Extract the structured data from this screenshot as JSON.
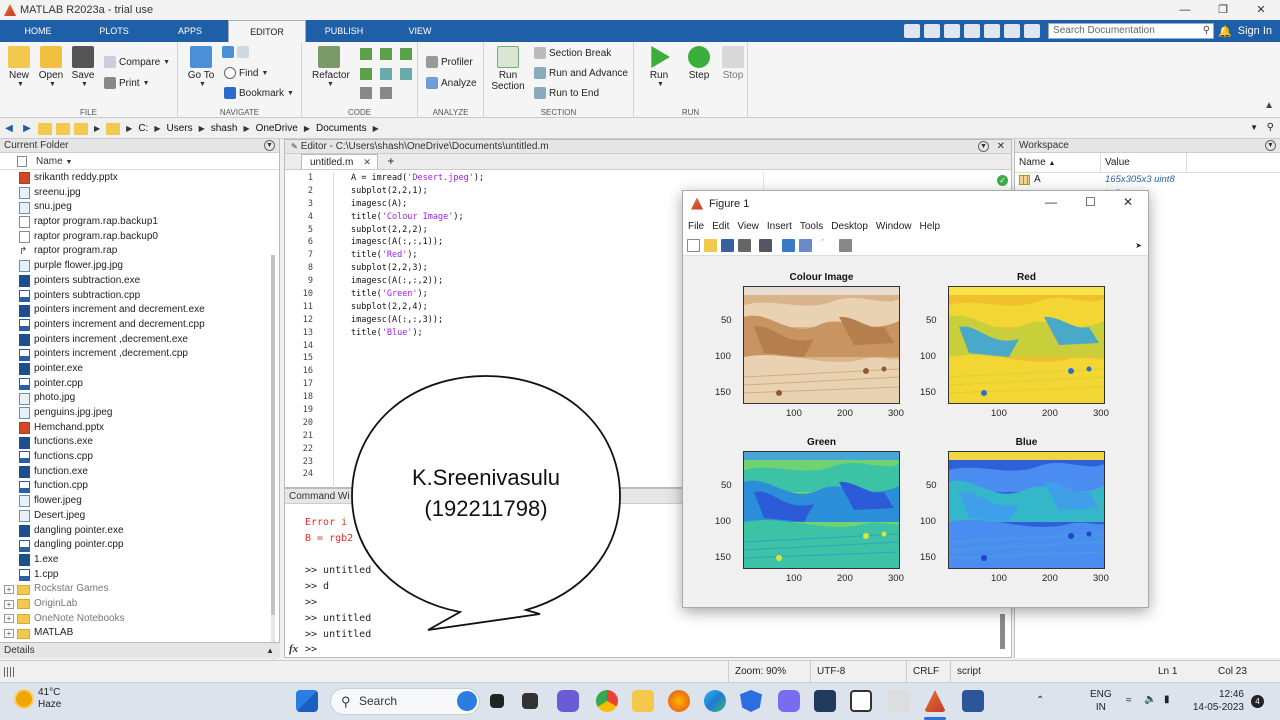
{
  "app": {
    "title": "MATLAB R2023a - trial use"
  },
  "tabs": [
    "HOME",
    "PLOTS",
    "APPS",
    "EDITOR",
    "PUBLISH",
    "VIEW"
  ],
  "active_tab": "EDITOR",
  "search": {
    "placeholder": "Search Documentation"
  },
  "signin": "Sign In",
  "ribbon": {
    "file": {
      "label": "FILE",
      "new": "New",
      "open": "Open",
      "save": "Save",
      "compare": "Compare",
      "print": "Print"
    },
    "navigate": {
      "label": "NAVIGATE",
      "goto": "Go To",
      "find": "Find",
      "bookmark": "Bookmark"
    },
    "code": {
      "label": "CODE",
      "refactor": "Refactor"
    },
    "analyze": {
      "label": "ANALYZE",
      "profiler": "Profiler",
      "analyze": "Analyze"
    },
    "section": {
      "label": "SECTION",
      "run_section": "Run\nSection",
      "section_break": "Section Break",
      "run_and_advance": "Run and Advance",
      "run_to_end": "Run to End"
    },
    "run": {
      "label": "RUN",
      "run": "Run",
      "step": "Step",
      "stop": "Stop"
    }
  },
  "address": [
    "C:",
    "Users",
    "shash",
    "OneDrive",
    "Documents"
  ],
  "current_folder": {
    "title": "Current Folder",
    "column": "Name",
    "files": [
      {
        "name": "srikanth reddy.pptx",
        "type": "ppt"
      },
      {
        "name": "sreenu.jpg",
        "type": "img"
      },
      {
        "name": "snu.jpeg",
        "type": "img"
      },
      {
        "name": "raptor program.rap.backup1",
        "type": "bak"
      },
      {
        "name": "raptor program.rap.backup0",
        "type": "bak"
      },
      {
        "name": "raptor program.rap",
        "type": "rap"
      },
      {
        "name": "purple flower.jpg.jpg",
        "type": "img"
      },
      {
        "name": "pointers subtraction.exe",
        "type": "exe"
      },
      {
        "name": "pointers subtraction.cpp",
        "type": "cpp"
      },
      {
        "name": "pointers increment and decrement.exe",
        "type": "exe"
      },
      {
        "name": "pointers increment and decrement.cpp",
        "type": "cpp"
      },
      {
        "name": "pointers increment ,decrement.exe",
        "type": "exe"
      },
      {
        "name": "pointers increment ,decrement.cpp",
        "type": "cpp"
      },
      {
        "name": "pointer.exe",
        "type": "exe"
      },
      {
        "name": "pointer.cpp",
        "type": "cpp"
      },
      {
        "name": "photo.jpg",
        "type": "img"
      },
      {
        "name": "penguins.jpg.jpeg",
        "type": "img"
      },
      {
        "name": "Hemchand.pptx",
        "type": "ppt"
      },
      {
        "name": "functions.exe",
        "type": "exe"
      },
      {
        "name": "functions.cpp",
        "type": "cpp"
      },
      {
        "name": "function.exe",
        "type": "exe"
      },
      {
        "name": "function.cpp",
        "type": "cpp"
      },
      {
        "name": "flower.jpeg",
        "type": "img"
      },
      {
        "name": "Desert.jpeg",
        "type": "img"
      },
      {
        "name": "dangling pointer.exe",
        "type": "exe"
      },
      {
        "name": "dangling pointer.cpp",
        "type": "cpp"
      },
      {
        "name": "1.exe",
        "type": "exe"
      },
      {
        "name": "1.cpp",
        "type": "cpp"
      }
    ],
    "folders": [
      "Rockstar Games",
      "OriginLab",
      "OneNote Notebooks",
      "MATLAB"
    ]
  },
  "details": "Details",
  "editor": {
    "path": "Editor - C:\\Users\\shash\\OneDrive\\Documents\\untitled.m",
    "tab": "untitled.m",
    "lines": [
      {
        "pre": "A = imread(",
        "str": "'Desert.jpeg'",
        "post": ");"
      },
      {
        "pre": "subplot(2,2,1);",
        "str": "",
        "post": ""
      },
      {
        "pre": "imagesc(A);",
        "str": "",
        "post": ""
      },
      {
        "pre": "title(",
        "str": "'Colour Image'",
        "post": ");"
      },
      {
        "pre": "subplot(2,2,2);",
        "str": "",
        "post": ""
      },
      {
        "pre": "imagesc(A(:,:,1));",
        "str": "",
        "post": ""
      },
      {
        "pre": "title(",
        "str": "'Red'",
        "post": ");"
      },
      {
        "pre": "subplot(2,2,3);",
        "str": "",
        "post": ""
      },
      {
        "pre": "imagesc(A(:,:,2));",
        "str": "",
        "post": ""
      },
      {
        "pre": "title(",
        "str": "'Green'",
        "post": ");"
      },
      {
        "pre": "subplot(2,2,4);",
        "str": "",
        "post": ""
      },
      {
        "pre": "imagesc(A(:,:,3));",
        "str": "",
        "post": ""
      },
      {
        "pre": "title(",
        "str": "'Blue'",
        "post": ");"
      }
    ],
    "line_count": 24
  },
  "command_window": {
    "title": "Command Wi",
    "lines": [
      {
        "text": "Error i",
        "err": true
      },
      {
        "text": "B = rgb2",
        "err": true
      },
      {
        "text": "",
        "err": false
      },
      {
        "text": ">> untitled",
        "err": false
      },
      {
        "text": ">> d",
        "err": false
      },
      {
        "text": ">>",
        "err": false
      },
      {
        "text": ">> untitled",
        "err": false
      },
      {
        "text": ">> untitled",
        "err": false
      }
    ],
    "prompt": ">>",
    "fx": "fx"
  },
  "workspace": {
    "title": "Workspace",
    "columns": [
      "Name",
      "Value"
    ],
    "rows": [
      {
        "name": "A",
        "value": "165x305x3 uint8"
      },
      {
        "name": "",
        "value": "int8"
      },
      {
        "name": "",
        "value": "ogical"
      }
    ]
  },
  "status": {
    "zoom": "Zoom: 90%",
    "encoding": "UTF-8",
    "eol": "CRLF",
    "type": "script",
    "ln": "Ln  1",
    "col": "Col  23"
  },
  "figure": {
    "title": "Figure 1",
    "menu": [
      "File",
      "Edit",
      "View",
      "Insert",
      "Tools",
      "Desktop",
      "Window",
      "Help"
    ],
    "plots": [
      {
        "title": "Colour Image",
        "yticks": [
          "50",
          "100",
          "150"
        ],
        "xticks": [
          "100",
          "200",
          "300"
        ],
        "scheme": "colour"
      },
      {
        "title": "Red",
        "yticks": [
          "50",
          "100",
          "150"
        ],
        "xticks": [
          "100",
          "200",
          "300"
        ],
        "scheme": "red"
      },
      {
        "title": "Green",
        "yticks": [
          "50",
          "100",
          "150"
        ],
        "xticks": [
          "100",
          "200",
          "300"
        ],
        "scheme": "green"
      },
      {
        "title": "Blue",
        "yticks": [
          "50",
          "100",
          "150"
        ],
        "xticks": [
          "100",
          "200",
          "300"
        ],
        "scheme": "blue"
      }
    ]
  },
  "bubble": {
    "line1": "K.Sreenivasulu",
    "line2": "(192211798)"
  },
  "taskbar": {
    "temp": "41°C",
    "weather": "Haze",
    "search": "Search",
    "lang1": "ENG",
    "lang2": "IN",
    "time": "12:46",
    "date": "14-05-2023",
    "notifications": "4"
  }
}
